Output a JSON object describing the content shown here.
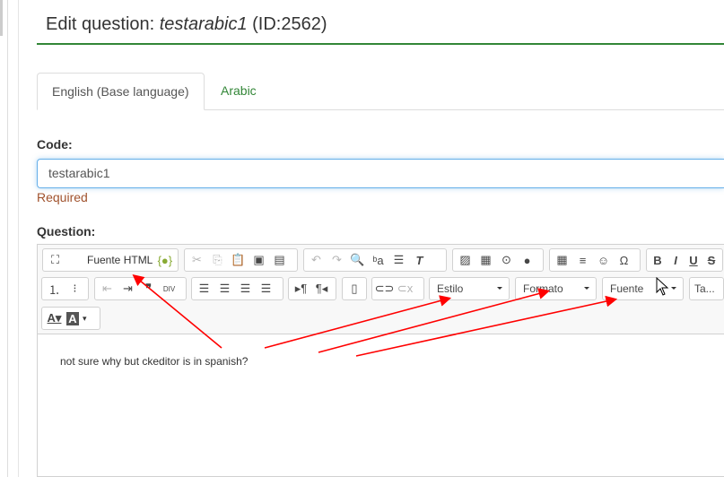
{
  "header": {
    "title_prefix": "Edit question: ",
    "title_code": "testarabic1",
    "title_suffix": " (ID:2562)"
  },
  "tabs": [
    {
      "label": "English (Base language)",
      "active": true
    },
    {
      "label": "Arabic",
      "active": false
    }
  ],
  "code": {
    "label": "Code:",
    "value": "testarabic1",
    "validation": "Required"
  },
  "question": {
    "label": "Question:"
  },
  "editor": {
    "source_label": "Fuente HTML",
    "combos": [
      "Estilo",
      "Formato",
      "Fuente",
      "Ta..."
    ],
    "content": "not sure why but ckeditor is in spanish?"
  },
  "colors": {
    "accent": "#328637",
    "required": "#a0522d",
    "annotation": "#ff0000"
  }
}
